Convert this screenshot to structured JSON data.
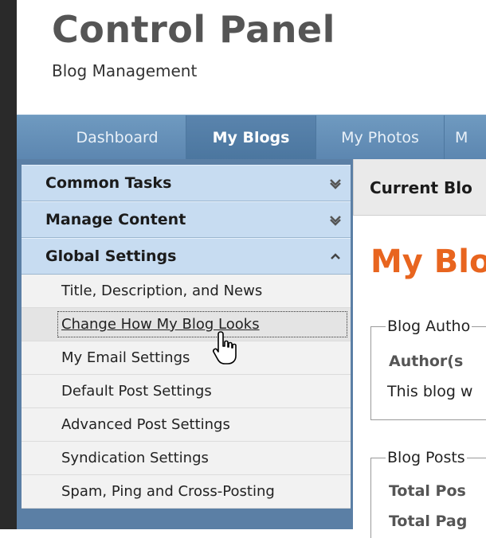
{
  "header": {
    "title": "Control Panel",
    "subtitle": "Blog Management"
  },
  "tabs": [
    {
      "label": "Dashboard",
      "active": false
    },
    {
      "label": "My Blogs",
      "active": true
    },
    {
      "label": "My Photos",
      "active": false
    },
    {
      "label": "M",
      "active": false
    }
  ],
  "sidebar": {
    "sections": [
      {
        "label": "Common Tasks",
        "state": "collapsed",
        "icon": "chevron-down-icon"
      },
      {
        "label": "Manage Content",
        "state": "collapsed",
        "icon": "chevron-down-icon"
      },
      {
        "label": "Global Settings",
        "state": "expanded",
        "icon": "chevron-up-icon"
      }
    ],
    "items": [
      {
        "label": "Title, Description, and News"
      },
      {
        "label": "Change How My Blog Looks",
        "hovered": true
      },
      {
        "label": "My Email Settings"
      },
      {
        "label": "Default Post Settings"
      },
      {
        "label": "Advanced Post Settings"
      },
      {
        "label": "Syndication Settings"
      },
      {
        "label": "Spam, Ping and Cross-Posting"
      }
    ]
  },
  "main": {
    "header": "Current Blo",
    "title": "My Blo",
    "authors_box": {
      "legend": "Blog Autho",
      "label": "Author(s",
      "text": "This blog w"
    },
    "posts_box": {
      "legend": "Blog Posts",
      "total_posts": "Total Pos",
      "total_pages": "Total Pag"
    }
  },
  "colors": {
    "accent": "#e8651f",
    "nav": "#5c86b0",
    "accordion": "#c7dcf1"
  }
}
